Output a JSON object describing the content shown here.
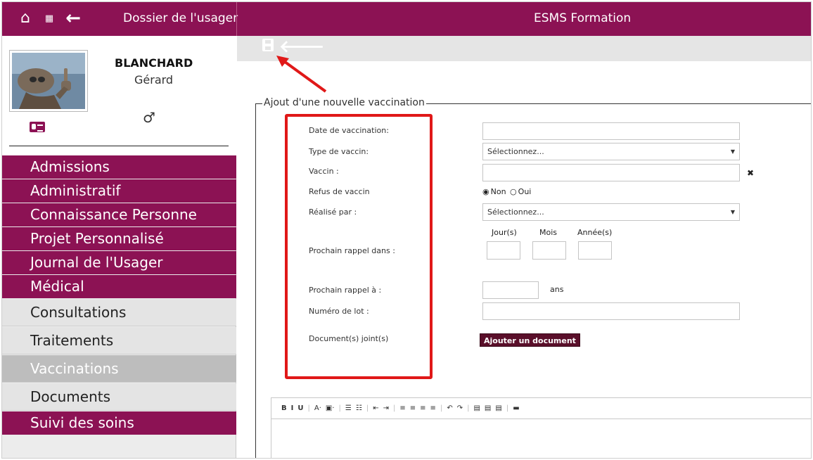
{
  "header": {
    "title": "Dossier de l'usager",
    "center_title": "ESMS Formation",
    "home_icon": "⌂",
    "grid_icon": "▦",
    "back_icon": "←"
  },
  "profile": {
    "last_name": "BLANCHARD",
    "first_name": "Gérard",
    "gender_symbol": "♂"
  },
  "sidebar": {
    "items": [
      {
        "label": "Admissions"
      },
      {
        "label": "Administratif"
      },
      {
        "label": "Connaissance Personne"
      },
      {
        "label": "Projet Personnalisé"
      },
      {
        "label": "Journal de l'Usager"
      },
      {
        "label": "Médical"
      },
      {
        "label": "Consultations"
      },
      {
        "label": "Traitements"
      },
      {
        "label": "Vaccinations"
      },
      {
        "label": "Documents"
      },
      {
        "label": "Suivi des soins"
      }
    ]
  },
  "toolbar": {
    "back_icon": "🡐"
  },
  "form": {
    "legend": "Ajout d'une nouvelle vaccination",
    "date_label": "Date de vaccination:",
    "type_label": "Type de vaccin:",
    "type_value": "Sélectionnez...",
    "vaccin_label": "Vaccin :",
    "refus_label": "Refus de vaccin",
    "radio_non": "Non",
    "radio_oui": "Oui",
    "radio_checked": "◉",
    "radio_unchecked": "○",
    "realise_label": "Réalisé par :",
    "realise_value": "Sélectionnez...",
    "days_label": "Jour(s)",
    "months_label": "Mois",
    "years_label": "Année(s)",
    "rappel_dans_label": "Prochain rappel dans :",
    "rappel_a_label": "Prochain rappel à :",
    "ans_label": "ans",
    "lot_label": "Numéro de lot :",
    "doc_label": "Document(s) joint(s)",
    "add_doc_button": "Ajouter un document",
    "select_arrow": "▼",
    "clear_icon": "✖"
  },
  "editor": {
    "toolbar": [
      "B",
      "I",
      "U",
      "|",
      "A·",
      "▣·",
      "|",
      "☰",
      "☷",
      "|",
      "⇤",
      "⇥",
      "|",
      "≡",
      "≡",
      "≡",
      "≡",
      "|",
      "↶",
      "↷",
      "|",
      "▤",
      "▤",
      "▤",
      "|",
      "▬"
    ]
  },
  "colors": {
    "brand": "#8c1254",
    "annotation": "#e01818"
  }
}
